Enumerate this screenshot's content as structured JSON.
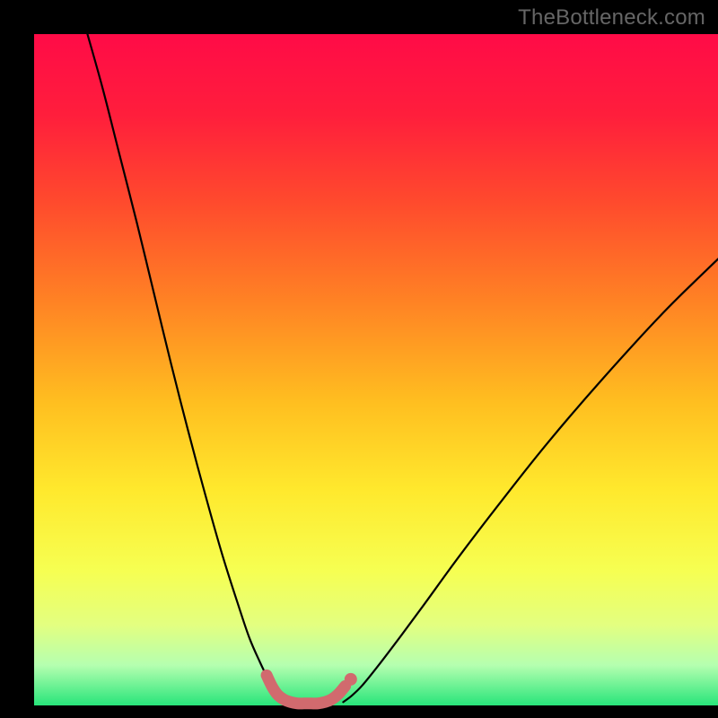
{
  "watermark": "TheBottleneck.com",
  "chart_data": {
    "type": "line",
    "title": "",
    "xlabel": "",
    "ylabel": "",
    "xlim": [
      0,
      100
    ],
    "ylim": [
      0,
      100
    ],
    "grid": false,
    "annotations": [],
    "background_gradient": {
      "stops": [
        {
          "offset": 0.0,
          "color": "#ff0b47"
        },
        {
          "offset": 0.12,
          "color": "#ff1e3c"
        },
        {
          "offset": 0.25,
          "color": "#ff4a2d"
        },
        {
          "offset": 0.4,
          "color": "#ff8324"
        },
        {
          "offset": 0.55,
          "color": "#ffbf20"
        },
        {
          "offset": 0.68,
          "color": "#ffe92d"
        },
        {
          "offset": 0.8,
          "color": "#f6ff52"
        },
        {
          "offset": 0.88,
          "color": "#e3ff80"
        },
        {
          "offset": 0.94,
          "color": "#b5ffb0"
        },
        {
          "offset": 1.0,
          "color": "#28e57a"
        }
      ]
    },
    "series": [
      {
        "name": "left-branch",
        "stroke": "#000000",
        "x": [
          7.8,
          10.0,
          12.5,
          15.0,
          17.5,
          20.0,
          22.5,
          25.0,
          27.5,
          30.0,
          31.5,
          33.0,
          34.2,
          35.2,
          36.0,
          36.7
        ],
        "y": [
          100.0,
          92.0,
          82.0,
          72.0,
          61.5,
          51.0,
          41.0,
          31.5,
          22.5,
          14.5,
          10.0,
          6.5,
          4.0,
          2.3,
          1.2,
          0.6
        ]
      },
      {
        "name": "right-branch",
        "stroke": "#000000",
        "x": [
          45.2,
          46.5,
          48.0,
          50.0,
          53.0,
          57.0,
          62.0,
          68.0,
          75.0,
          83.0,
          92.0,
          100.0
        ],
        "y": [
          0.5,
          1.5,
          3.0,
          5.5,
          9.5,
          15.0,
          22.0,
          30.0,
          39.0,
          48.5,
          58.5,
          66.5
        ]
      },
      {
        "name": "valley-highlight",
        "stroke": "#d16a6e",
        "thick": true,
        "x": [
          34.0,
          34.8,
          35.6,
          36.5,
          37.5,
          38.5,
          39.5,
          40.5,
          41.5,
          42.5,
          43.5,
          44.5,
          45.5
        ],
        "y": [
          4.5,
          2.8,
          1.6,
          0.9,
          0.5,
          0.3,
          0.3,
          0.3,
          0.3,
          0.5,
          0.9,
          1.7,
          2.9
        ]
      }
    ],
    "dot": {
      "x": 46.3,
      "y": 3.9,
      "color": "#d16a6e"
    }
  }
}
